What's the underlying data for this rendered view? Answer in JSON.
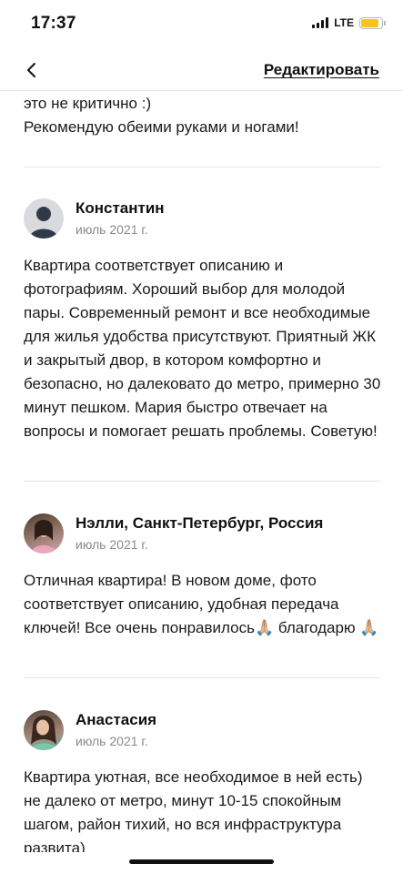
{
  "status_bar": {
    "time": "17:37",
    "network": "LTE",
    "battery_level": 0.85,
    "battery_color": "#f5c518"
  },
  "nav": {
    "back_icon": "chevron-left-icon",
    "edit_label": "Редактировать"
  },
  "partial_review": {
    "text": "это не критично :)\nРекомендую обеими руками и ногами!"
  },
  "reviews": [
    {
      "author": "Константин",
      "date": "июль 2021 г.",
      "avatar": "default-user-icon",
      "text": "Квартира соответствует описанию и фотографиям. Хороший выбор для молодой пары. Современный ремонт и все необходимые для жилья удобства присутствуют. Приятный ЖК и закрытый двор, в котором комфортно и безопасно, но далековато до метро, примерно 30 минут пешком. Мария быстро отвечает на вопросы и помогает решать проблемы. Советую!"
    },
    {
      "author": "Нэлли, Санкт-Петербург, Россия",
      "date": "июль 2021 г.",
      "avatar": "user-photo",
      "text": "Отличная квартира! В новом доме, фото соответствует описанию, удобная передача ключей! Все очень понравилось🙏🏼 благодарю 🙏🏼"
    },
    {
      "author": "Анастасия",
      "date": "июль 2021 г.",
      "avatar": "user-photo",
      "text": "Квартира уютная, все необходимое в ней есть) не далеко от метро, минут 10-15 спокойным шагом, район тихий, но вся инфраструктура развита)"
    }
  ]
}
